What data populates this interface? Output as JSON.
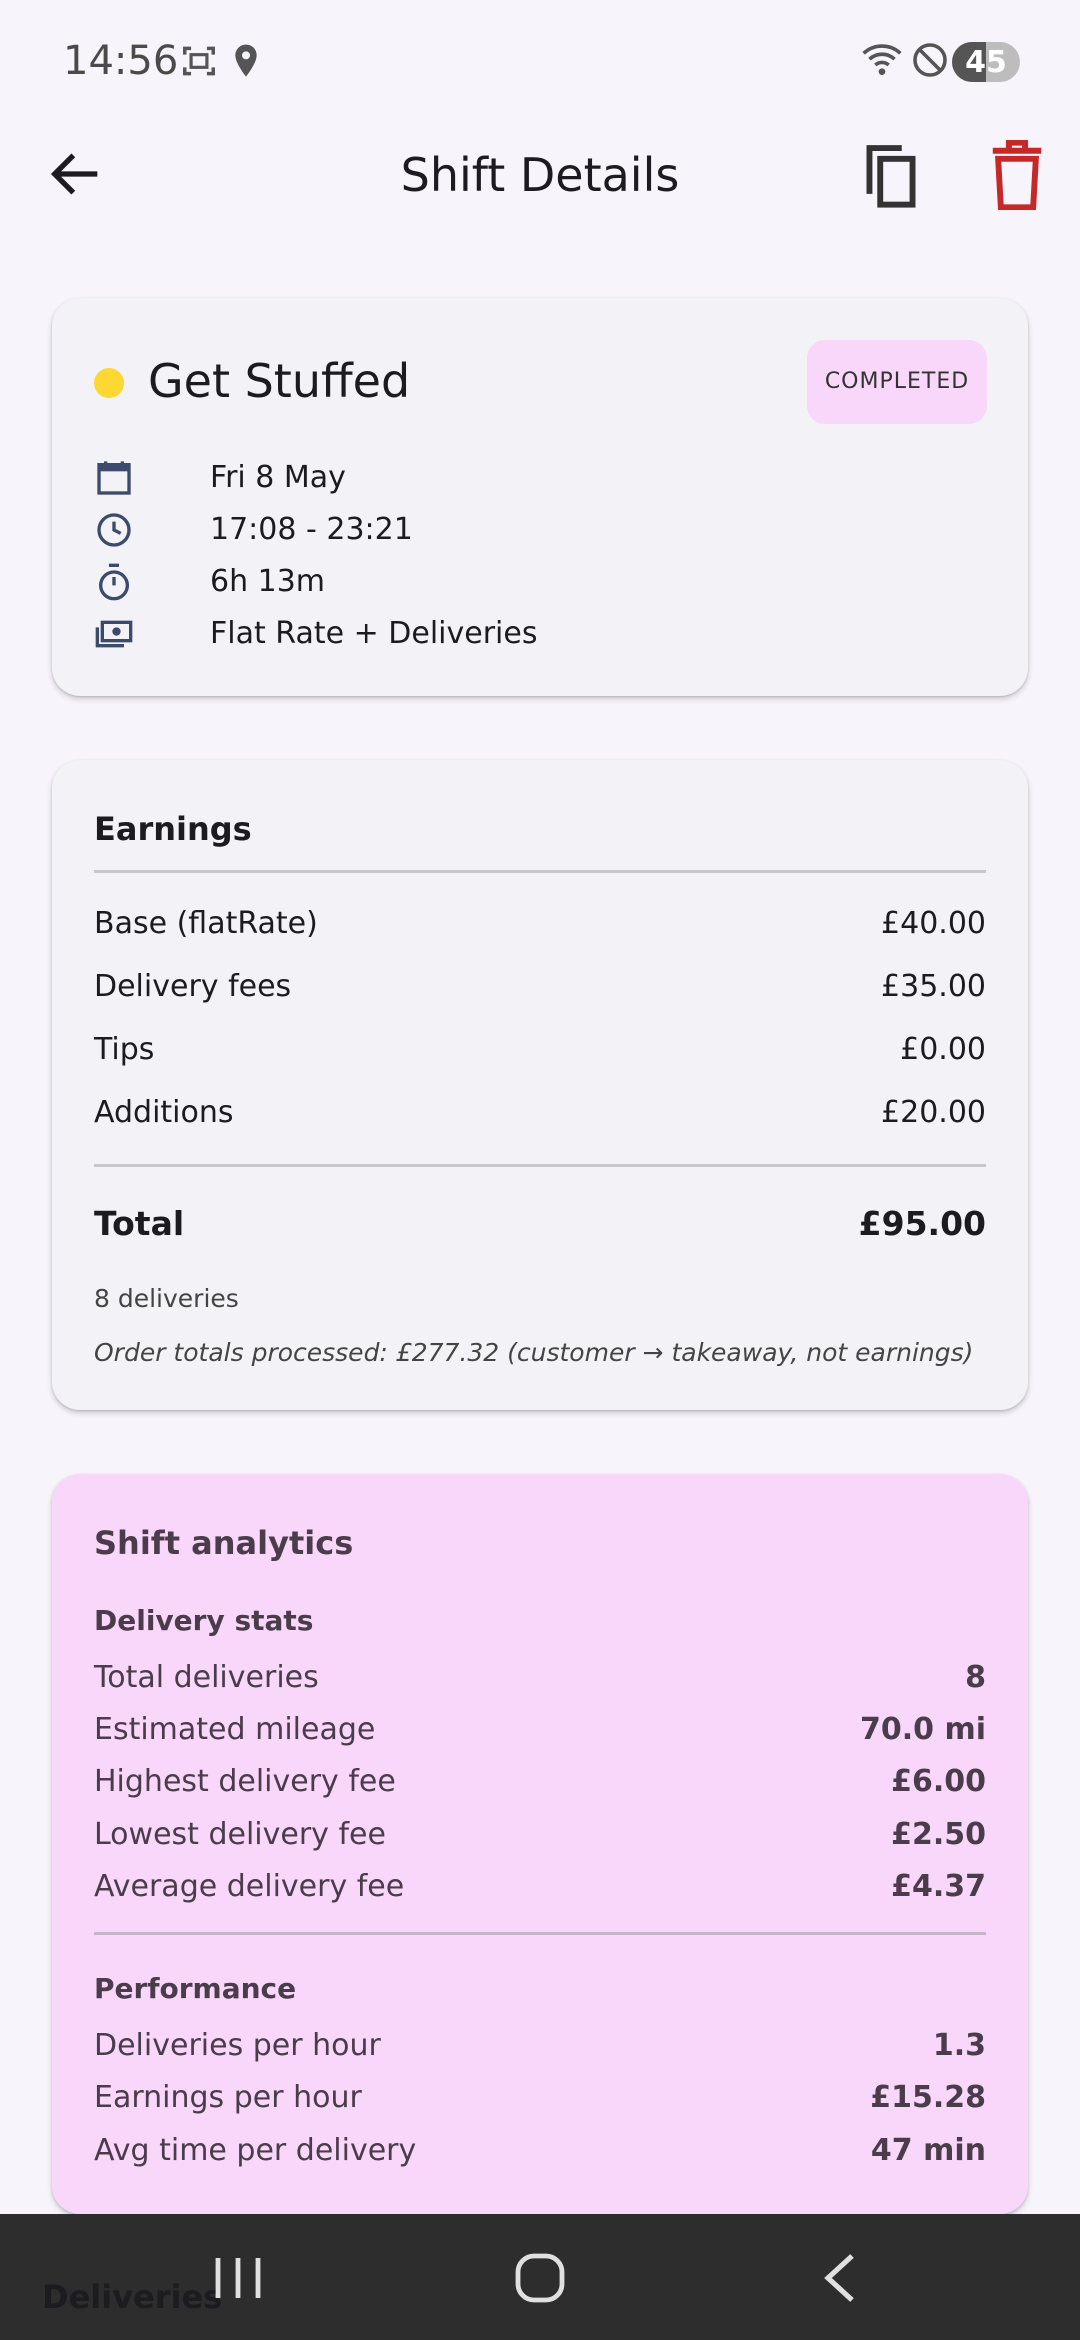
{
  "status_bar": {
    "time": "14:56",
    "battery": "45",
    "icons": [
      "screenshot-icon",
      "location-icon",
      "wifi-icon",
      "do-not-disturb-icon"
    ]
  },
  "app_bar": {
    "title": "Shift Details",
    "icons": [
      "back-arrow-icon",
      "copy-icon",
      "delete-icon"
    ],
    "delete_color": "#c62828"
  },
  "shift": {
    "restaurant": "Get Stuffed",
    "restaurant_color": "#fdd835",
    "status": "COMPLETED",
    "date": "Fri 8 May",
    "time_range": "17:08 - 23:21",
    "duration": "6h 13m",
    "pay_type": "Flat Rate + Deliveries"
  },
  "earnings": {
    "title": "Earnings",
    "rows": [
      {
        "label": "Base (flatRate)",
        "value": "£40.00"
      },
      {
        "label": "Delivery fees",
        "value": "£35.00"
      },
      {
        "label": "Tips",
        "value": "£0.00"
      },
      {
        "label": "Additions",
        "value": "£20.00"
      }
    ],
    "total_label": "Total",
    "total_value": "£95.00",
    "deliveries_count": "8 deliveries",
    "order_totals_note": "Order totals processed: £277.32 (customer → takeaway, not earnings)"
  },
  "analytics": {
    "title": "Shift analytics",
    "background": "#f8d7fa",
    "delivery_stats_title": "Delivery stats",
    "delivery_stats": [
      {
        "label": "Total deliveries",
        "value": "8"
      },
      {
        "label": "Estimated mileage",
        "value": "70.0 mi"
      },
      {
        "label": "Highest delivery fee",
        "value": "£6.00"
      },
      {
        "label": "Lowest delivery fee",
        "value": "£2.50"
      },
      {
        "label": "Average delivery fee",
        "value": "£4.37"
      }
    ],
    "performance_title": "Performance",
    "performance": [
      {
        "label": "Deliveries per hour",
        "value": "1.3"
      },
      {
        "label": "Earnings per hour",
        "value": "£15.28"
      },
      {
        "label": "Avg time per delivery",
        "value": "47 min"
      }
    ]
  },
  "bottom": {
    "peek_label": "Deliveries",
    "nav_icons": [
      "recent-apps-icon",
      "home-icon",
      "system-back-icon"
    ]
  }
}
